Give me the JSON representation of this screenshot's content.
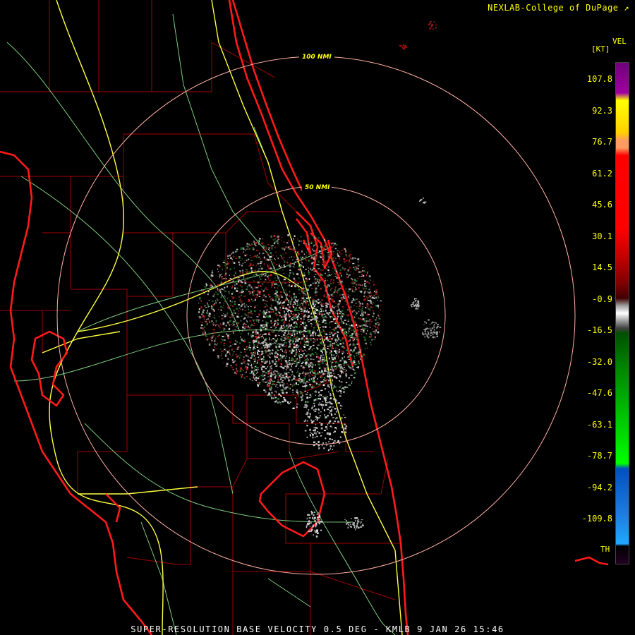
{
  "credit": "NEXLAB-College of DuPage",
  "credit_icon": "external-link-icon",
  "legend": {
    "product": "VEL",
    "unit": "[KT]",
    "ticks": [
      "107.8",
      "92.3",
      "76.7",
      "61.2",
      "45.6",
      "30.1",
      "14.5",
      "-0.9",
      "-16.5",
      "-32.0",
      "-47.6",
      "-63.1",
      "-78.7",
      "-94.2",
      "-109.8"
    ],
    "footer_label": "TH"
  },
  "rings": [
    {
      "label": "100 NMI"
    },
    {
      "label": "50 NMI"
    }
  ],
  "footer": "SUPER-RESOLUTION BASE VELOCITY 0.5 DEG - KMLB 9 JAN 26 15:46",
  "colors": {
    "coast": "#ff1a1a",
    "county": "#b00000",
    "highway_major": "#ffff40",
    "highway_minor": "#80d080",
    "ring": "#ffb0a0",
    "label": "#ffff00"
  }
}
